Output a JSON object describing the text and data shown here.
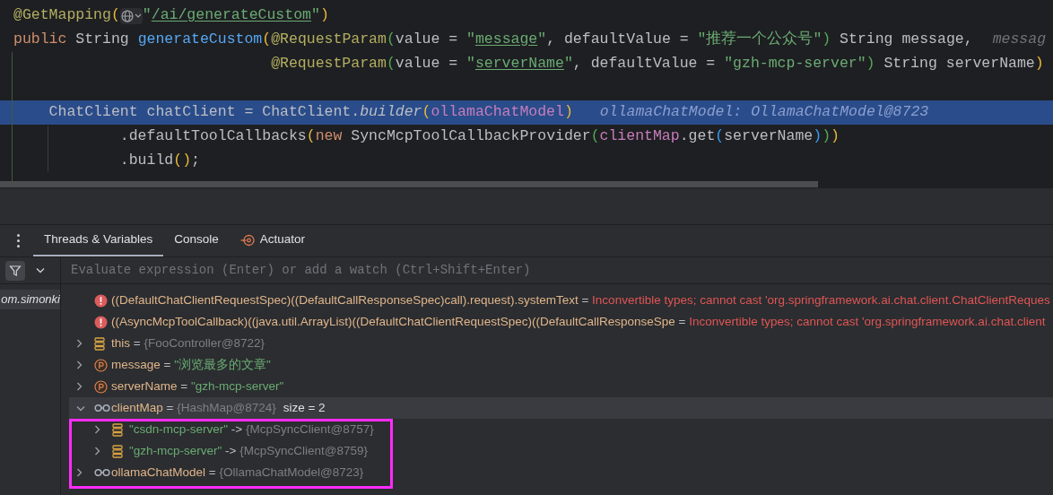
{
  "editor": {
    "lines": [
      {
        "highlighted": false,
        "tokens": [
          {
            "t": "@GetMapping",
            "kind": "annotation"
          },
          {
            "t": "(",
            "kind": "bracket1"
          },
          {
            "t": "\"",
            "kind": "string"
          },
          {
            "t": "/ai/generateCustom",
            "kind": "link"
          },
          {
            "t": "\"",
            "kind": "string"
          },
          {
            "t": ")",
            "kind": "bracket1"
          }
        ]
      },
      {
        "highlighted": false,
        "tokens": [
          {
            "t": "public",
            "kind": "keyword"
          },
          {
            "t": " String ",
            "kind": "plain"
          },
          {
            "t": "generateCustom",
            "kind": "method"
          },
          {
            "t": "(",
            "kind": "bracket1"
          },
          {
            "t": "@RequestParam",
            "kind": "annotation"
          },
          {
            "t": "(",
            "kind": "bracket2"
          },
          {
            "t": "value = ",
            "kind": "plain"
          },
          {
            "t": "\"",
            "kind": "string"
          },
          {
            "t": "message",
            "kind": "link"
          },
          {
            "t": "\"",
            "kind": "string"
          },
          {
            "t": ", defaultValue = ",
            "kind": "plain"
          },
          {
            "t": "\"推荐一个公众号\"",
            "kind": "string"
          },
          {
            "t": ")",
            "kind": "bracket2"
          },
          {
            "t": " String message,",
            "kind": "plain"
          },
          {
            "t": "messag",
            "kind": "hint"
          }
        ]
      },
      {
        "highlighted": false,
        "tokens": [
          {
            "t": "                             @RequestParam",
            "kind": "annotation"
          },
          {
            "t": "(",
            "kind": "bracket2"
          },
          {
            "t": "value = ",
            "kind": "plain"
          },
          {
            "t": "\"",
            "kind": "string"
          },
          {
            "t": "serverName",
            "kind": "link"
          },
          {
            "t": "\"",
            "kind": "string"
          },
          {
            "t": ", defaultValue = ",
            "kind": "plain"
          },
          {
            "t": "\"gzh-mcp-server\"",
            "kind": "string"
          },
          {
            "t": ")",
            "kind": "bracket2"
          },
          {
            "t": " String serverName",
            "kind": "plain"
          },
          {
            "t": ")",
            "kind": "bracket1"
          }
        ]
      },
      {
        "highlighted": false
      },
      {
        "highlighted": true,
        "tokens": [
          {
            "t": "    ChatClient chatClient = ChatClient.",
            "kind": "plain"
          },
          {
            "t": "builder",
            "kind": "italic"
          },
          {
            "t": "(",
            "kind": "bracket1"
          },
          {
            "t": "ollamaChatModel",
            "kind": "field"
          },
          {
            "t": ")",
            "kind": "bracket1"
          },
          {
            "t": "ollamaChatModel: OllamaChatModel@8723",
            "kind": "debug"
          }
        ]
      },
      {
        "highlighted": false,
        "tokens": [
          {
            "t": "            .defaultToolCallbacks",
            "kind": "plain"
          },
          {
            "t": "(",
            "kind": "bracket1"
          },
          {
            "t": "new",
            "kind": "keyword"
          },
          {
            "t": " SyncMcpToolCallbackProvider",
            "kind": "plain"
          },
          {
            "t": "(",
            "kind": "bracket2"
          },
          {
            "t": "clientMap",
            "kind": "field"
          },
          {
            "t": ".get",
            "kind": "plain"
          },
          {
            "t": "(",
            "kind": "bracket3"
          },
          {
            "t": "serverName",
            "kind": "plain"
          },
          {
            "t": ")",
            "kind": "bracket3"
          },
          {
            "t": ")",
            "kind": "bracket2"
          },
          {
            "t": ")",
            "kind": "bracket1"
          }
        ]
      },
      {
        "highlighted": false,
        "tokens": [
          {
            "t": "            .build",
            "kind": "plain"
          },
          {
            "t": "()",
            "kind": "bracket1"
          },
          {
            "t": ";",
            "kind": "plain"
          }
        ]
      }
    ]
  },
  "debugger": {
    "tabs": [
      {
        "label": "Threads & Variables",
        "selected": true
      },
      {
        "label": "Console",
        "selected": false
      },
      {
        "label": "Actuator",
        "selected": false
      }
    ],
    "frames": [
      {
        "label": "om.simonki",
        "selected": true
      }
    ],
    "evaluate": {
      "placeholder": "Evaluate expression (Enter) or add a watch (Ctrl+Shift+Enter)"
    },
    "variables": [
      {
        "kind": "error",
        "name": "((DefaultChatClientRequestSpec)((DefaultCallResponseSpec)call).request).systemText",
        "sep": " = ",
        "value": {
          "kind": "error",
          "text": "Inconvertible types; cannot cast 'org.springframework.ai.chat.client.ChatClientReques"
        },
        "selected": false
      },
      {
        "kind": "error",
        "name": "((AsyncMcpToolCallback)((java.util.ArrayList)((DefaultChatClientRequestSpec)((DefaultCallResponseSpe",
        "sep": " = ",
        "value": {
          "kind": "error",
          "text": "Inconvertible types; cannot cast 'org.springframework.ai.chat.client"
        },
        "selected": false
      },
      {
        "kind": "field",
        "name": "this",
        "sep": " = ",
        "value": {
          "kind": "object",
          "text": "{FooController@8722}"
        },
        "expanded": false,
        "selected": false
      },
      {
        "kind": "parameter",
        "name": "message",
        "sep": " = ",
        "value": {
          "kind": "string",
          "text": "\"浏览最多的文章\""
        },
        "expanded": false,
        "selected": false
      },
      {
        "kind": "parameter",
        "name": "serverName",
        "sep": " = ",
        "value": {
          "kind": "string",
          "text": "\"gzh-mcp-server\""
        },
        "expanded": false,
        "selected": false
      },
      {
        "kind": "watch",
        "name": "clientMap",
        "sep": " = ",
        "value": {
          "kind": "object",
          "text": "{HashMap@8724}"
        },
        "extra": "size = 2",
        "expanded": true,
        "selected": true,
        "children": [
          {
            "kind": "entry",
            "name": "\"csdn-mcp-server\"",
            "sep": " -> ",
            "value": {
              "kind": "object",
              "text": "{McpSyncClient@8757}"
            },
            "expanded": false,
            "selected": false
          },
          {
            "kind": "entry",
            "name": "\"gzh-mcp-server\"",
            "sep": " -> ",
            "value": {
              "kind": "object",
              "text": "{McpSyncClient@8759}"
            },
            "expanded": false,
            "selected": false
          }
        ]
      },
      {
        "kind": "watch",
        "name": "ollamaChatModel",
        "sep": " = ",
        "value": {
          "kind": "object",
          "text": "{OllamaChatModel@8723}"
        },
        "expanded": false,
        "selected": false
      }
    ]
  }
}
